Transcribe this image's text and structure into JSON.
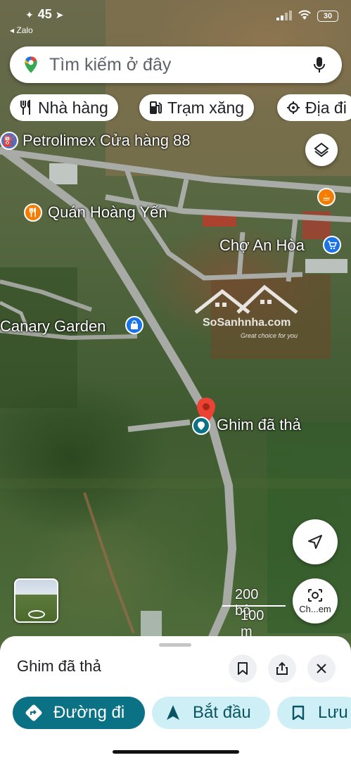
{
  "status_bar": {
    "time": "45",
    "back_app": "◂ Zalo",
    "battery": "30"
  },
  "search": {
    "placeholder": "Tìm kiếm ở đây",
    "icons": [
      "maps-pin-icon",
      "mic-icon"
    ]
  },
  "chips": [
    {
      "label": "Nhà hàng",
      "icon": "restaurant-icon"
    },
    {
      "label": "Trạm xăng",
      "icon": "gas-station-icon"
    },
    {
      "label": "Địa đi",
      "icon": "attraction-icon"
    }
  ],
  "map_labels": {
    "petrolimex": "Petrolimex Cửa hàng 88",
    "quan_hoang_yen": "Quán Hoàng Yến",
    "cho_an_hoa": "Chợ An Hòa",
    "canary_garden": "Canary Garden",
    "dropped_pin": "Ghim đã thả"
  },
  "colors": {
    "accent": "#0b7285",
    "chip_accent_light": "#cfeff7",
    "restaurant": "#f57c00",
    "fuel": "#5c6bc0",
    "shopping": "#1a73e8",
    "pin_red": "#ea4335"
  },
  "watermark": {
    "brand": "SoSanhnha.com",
    "tagline": "Great choice for you"
  },
  "map_controls": {
    "lens_label": "Ch...em"
  },
  "scale": {
    "imperial": "200 bộ",
    "metric": "100 m"
  },
  "sheet": {
    "title": "Ghim đã thả",
    "actions": {
      "directions": "Đường đi",
      "start": "Bắt đầu",
      "save": "Lưu"
    }
  }
}
